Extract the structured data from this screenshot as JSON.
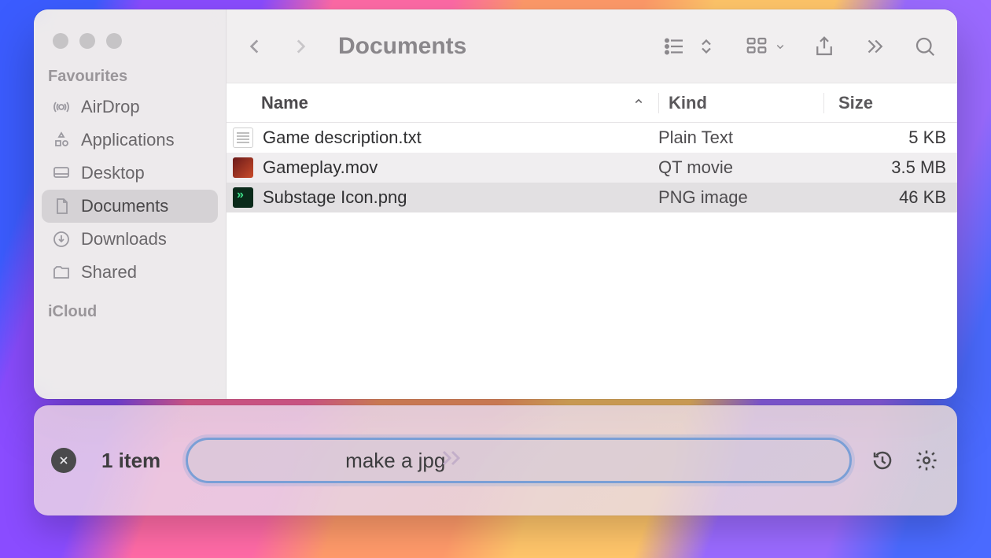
{
  "window": {
    "title": "Documents"
  },
  "sidebar": {
    "sections": {
      "favourites_label": "Favourites",
      "icloud_label": "iCloud"
    },
    "items": [
      {
        "label": "AirDrop",
        "icon": "airdrop-icon",
        "active": false
      },
      {
        "label": "Applications",
        "icon": "apps-icon",
        "active": false
      },
      {
        "label": "Desktop",
        "icon": "desktop-icon",
        "active": false
      },
      {
        "label": "Documents",
        "icon": "documents-icon",
        "active": true
      },
      {
        "label": "Downloads",
        "icon": "downloads-icon",
        "active": false
      },
      {
        "label": "Shared",
        "icon": "shared-icon",
        "active": false
      }
    ]
  },
  "columns": {
    "name": "Name",
    "kind": "Kind",
    "size": "Size"
  },
  "files": [
    {
      "name": "Game description.txt",
      "kind": "Plain Text",
      "size": "5 KB",
      "icon": "txt",
      "selected": false
    },
    {
      "name": "Gameplay.mov",
      "kind": "QT movie",
      "size": "3.5 MB",
      "icon": "mov",
      "selected": false
    },
    {
      "name": "Substage Icon.png",
      "kind": "PNG image",
      "size": "46 KB",
      "icon": "png",
      "selected": true
    }
  ],
  "substage": {
    "item_count": "1 item",
    "command_value": "make a jpg"
  }
}
